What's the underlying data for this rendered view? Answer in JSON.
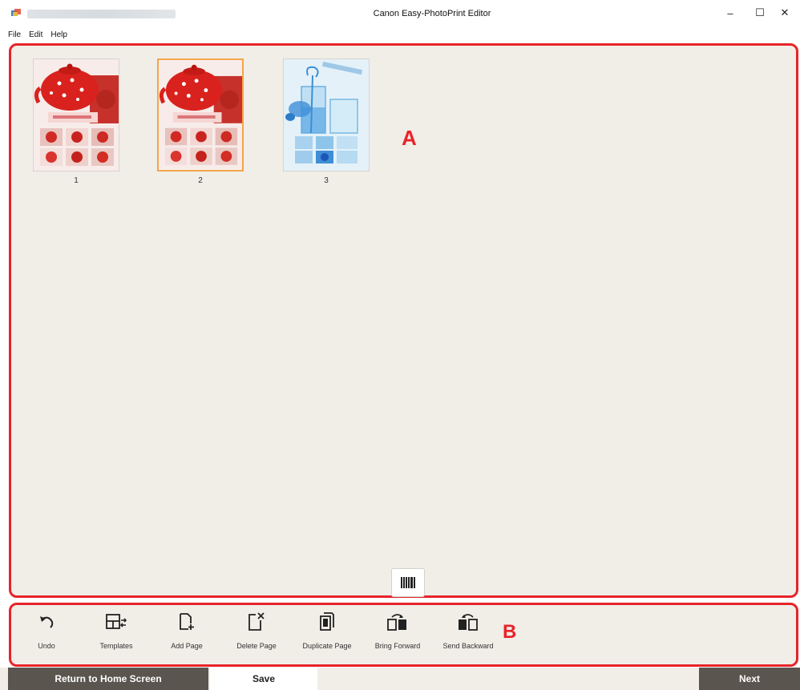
{
  "window": {
    "title": "Canon Easy-PhotoPrint Editor",
    "minimize": "–",
    "maximize": "☐",
    "close": "✕"
  },
  "menu": [
    "File",
    "Edit",
    "Help"
  ],
  "pages": [
    {
      "number": "1",
      "theme": "red-teapot",
      "selected": false
    },
    {
      "number": "2",
      "theme": "red-teapot",
      "selected": true
    },
    {
      "number": "3",
      "theme": "blue-glass",
      "selected": false
    }
  ],
  "annotations": {
    "area_a": "A",
    "area_b": "B"
  },
  "toolbar": {
    "undo": "Undo",
    "templates": "Templates",
    "add_page": "Add Page",
    "delete_page": "Delete Page",
    "duplicate_page": "Duplicate Page",
    "bring_forward": "Bring Forward",
    "send_backward": "Send Backward"
  },
  "footer": {
    "return_home": "Return to Home Screen",
    "save": "Save",
    "next": "Next"
  },
  "colors": {
    "accent_red": "#e8232a",
    "background": "#f1ede7",
    "selected_border": "#f5a54a",
    "button_dark": "#5a554f"
  }
}
